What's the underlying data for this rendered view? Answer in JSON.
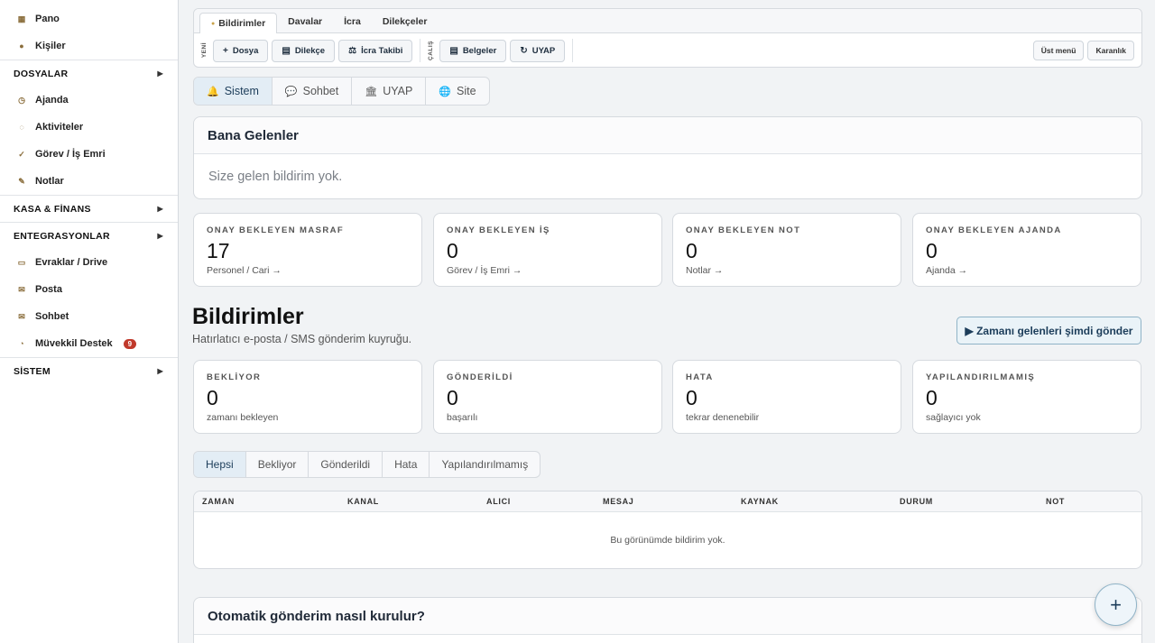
{
  "sidebar": {
    "top_items": [
      {
        "label": "Pano",
        "icon": "dashboard-icon",
        "glyph": "▦"
      },
      {
        "label": "Kişiler",
        "icon": "contacts-icon",
        "glyph": "●"
      }
    ],
    "dosyalar": {
      "label": "DOSYALAR",
      "arrow": "▶"
    },
    "dosyalar_items": [
      {
        "label": "Ajanda",
        "icon": "clock-icon",
        "glyph": "◷"
      },
      {
        "label": "Aktiviteler",
        "icon": "activity-icon",
        "glyph": "◌"
      },
      {
        "label": "Görev / İş Emri",
        "icon": "check-icon",
        "glyph": "✓"
      },
      {
        "label": "Notlar",
        "icon": "pencil-icon",
        "glyph": "✎"
      }
    ],
    "kasa": {
      "label": "KASA & FİNANS",
      "arrow": "▶"
    },
    "entegrasyon": {
      "label": "ENTEGRASYONLAR",
      "arrow": "▶"
    },
    "entegrasyon_items": [
      {
        "label": "Evraklar / Drive",
        "icon": "folder-icon",
        "glyph": "▭"
      },
      {
        "label": "Posta",
        "icon": "mail-icon",
        "glyph": "✉"
      },
      {
        "label": "Sohbet",
        "icon": "chat-icon",
        "glyph": "✉"
      },
      {
        "label": "Müvekkil Destek",
        "icon": "support-icon",
        "glyph": "◔",
        "badge": "9"
      }
    ],
    "sistem": {
      "label": "SİSTEM",
      "arrow": "▶"
    }
  },
  "topbar": {
    "tabs": [
      "Bildirimler",
      "Davalar",
      "İcra",
      "Dilekçeler"
    ],
    "new_label": "YENİ",
    "work_label": "ÇALIŞ",
    "new_buttons": [
      {
        "label": "Dosya",
        "glyph": "+"
      },
      {
        "label": "Dilekçe",
        "glyph": "▤"
      },
      {
        "label": "İcra Takibi",
        "glyph": "⚖"
      }
    ],
    "work_buttons": [
      {
        "label": "Belgeler",
        "glyph": "▤"
      },
      {
        "label": "UYAP",
        "glyph": "↻"
      }
    ],
    "ust_menu": "Üst menü",
    "karanlik": "Karanlık"
  },
  "channel_tabs": [
    {
      "label": "Sistem",
      "glyph": "🔔"
    },
    {
      "label": "Sohbet",
      "glyph": "💬"
    },
    {
      "label": "UYAP",
      "glyph": "🏛"
    },
    {
      "label": "Site",
      "glyph": "🌐"
    }
  ],
  "bana_gelenler": {
    "title": "Bana Gelenler",
    "empty": "Size gelen bildirim yok."
  },
  "approval_stats": [
    {
      "label": "ONAY BEKLEYEN MASRAF",
      "value": "17",
      "sub": "Personel / Cari →"
    },
    {
      "label": "ONAY BEKLEYEN İŞ",
      "value": "0",
      "sub": "Görev / İş Emri →"
    },
    {
      "label": "ONAY BEKLEYEN NOT",
      "value": "0",
      "sub": "Notlar →"
    },
    {
      "label": "ONAY BEKLEYEN AJANDA",
      "value": "0",
      "sub": "Ajanda →"
    }
  ],
  "notifications": {
    "title": "Bildirimler",
    "subtitle": "Hatırlatıcı e-posta / SMS gönderim kuyruğu.",
    "send_button": "▶ Zamanı gelenleri şimdi gönder"
  },
  "queue_stats": [
    {
      "label": "BEKLİYOR",
      "value": "0",
      "sub": "zamanı bekleyen"
    },
    {
      "label": "GÖNDERİLDİ",
      "value": "0",
      "sub": "başarılı"
    },
    {
      "label": "HATA",
      "value": "0",
      "sub": "tekrar denenebilir"
    },
    {
      "label": "YAPILANDIRILMAMIŞ",
      "value": "0",
      "sub": "sağlayıcı yok"
    }
  ],
  "filters": [
    "Hepsi",
    "Bekliyor",
    "Gönderildi",
    "Hata",
    "Yapılandırılmamış"
  ],
  "table": {
    "columns": [
      "ZAMAN",
      "KANAL",
      "ALICI",
      "MESAJ",
      "KAYNAK",
      "DURUM",
      "NOT"
    ],
    "empty": "Bu görünümde bildirim yok."
  },
  "auto": {
    "title": "Otomatik gönderim nasıl kurulur?"
  },
  "fab": "+"
}
